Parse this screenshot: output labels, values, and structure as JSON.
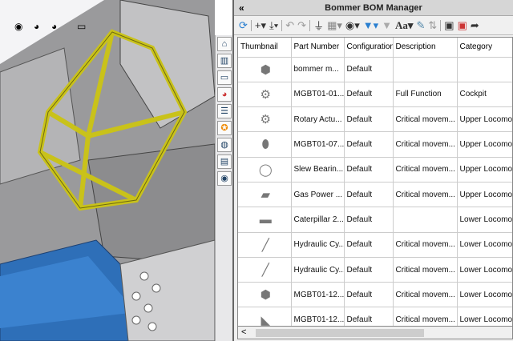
{
  "viewport": {
    "tools": [
      "view-orientation",
      "appearance",
      "scene",
      "display"
    ]
  },
  "panel": {
    "title": "Bommer BOM Manager",
    "collapse": "«"
  },
  "toolbar": [
    "refresh",
    "add",
    "import",
    "undo",
    "redo",
    "level",
    "columns",
    "view",
    "filter",
    "clear-filter",
    "font",
    "edit",
    "sort",
    "save",
    "save-as",
    "export"
  ],
  "table": {
    "columns": [
      "Thumbnail",
      "Part Number",
      "Configuration",
      "Description",
      "Category"
    ],
    "rows": [
      [
        "⬢",
        "bommer m...",
        "Default",
        "",
        ""
      ],
      [
        "⚙",
        "MGBT01-01...",
        "Default",
        "Full Function",
        "Cockpit"
      ],
      [
        "⚙",
        "Rotary Actu...",
        "Default",
        "Critical movem...",
        "Upper Locomo..."
      ],
      [
        "⬮",
        "MGBT01-07...",
        "Default",
        "Critical movem...",
        "Upper Locomo..."
      ],
      [
        "◯",
        "Slew Bearin...",
        "Default",
        "Critical movem...",
        "Upper Locomo..."
      ],
      [
        "▰",
        "Gas Power ...",
        "Default",
        "Critical movem...",
        "Upper Locomo..."
      ],
      [
        "▬",
        "Caterpillar 2...",
        "Default",
        "",
        "Lower Locomo..."
      ],
      [
        "╱",
        "Hydraulic Cy...",
        "Default",
        "Critical movem...",
        "Lower Locomo..."
      ],
      [
        "╱",
        "Hydraulic Cy...",
        "Default",
        "Critical movem...",
        "Lower Locomo..."
      ],
      [
        "⬢",
        "MGBT01-12...",
        "Default",
        "Critical movem...",
        "Lower Locomo..."
      ],
      [
        "◣",
        "MGBT01-12...",
        "Default",
        "Critical movem...",
        "Lower Locomo..."
      ]
    ]
  },
  "scroll": {
    "left": "<"
  }
}
